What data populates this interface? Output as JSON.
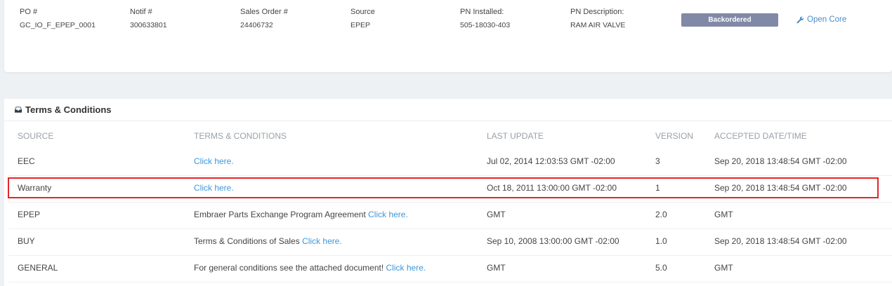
{
  "order": {
    "po_label": "PO #",
    "po_value": "GC_IO_F_EPEP_0001",
    "notif_label": "Notif #",
    "notif_value": "300633801",
    "sales_label": "Sales Order #",
    "sales_value": "24406732",
    "source_label": "Source",
    "source_value": "EPEP",
    "pn_installed_label": "PN Installed:",
    "pn_installed_value": "505-18030-403",
    "pn_desc_label": "PN Description:",
    "pn_desc_value": "RAM AIR VALVE",
    "status_badge": "Backordered",
    "open_core": "Open Core"
  },
  "terms": {
    "title": "Terms & Conditions",
    "headers": {
      "source": "SOURCE",
      "terms": "TERMS & CONDITIONS",
      "last_update": "LAST UPDATE",
      "version": "VERSION",
      "accepted": "ACCEPTED DATE/TIME"
    },
    "rows": [
      {
        "source": "EEC",
        "text": "",
        "link": "Click here.",
        "last_update": "Jul 02, 2014 12:03:53 GMT -02:00",
        "version": "3",
        "accepted": "Sep 20, 2018 13:48:54 GMT -02:00"
      },
      {
        "source": "Warranty",
        "text": "",
        "link": "Click here.",
        "last_update": "Oct 18, 2011 13:00:00 GMT -02:00",
        "version": "1",
        "accepted": "Sep 20, 2018 13:48:54 GMT -02:00"
      },
      {
        "source": "EPEP",
        "text": "Embraer Parts Exchange Program Agreement ",
        "link": "Click here.",
        "last_update": "GMT",
        "version": "2.0",
        "accepted": "GMT"
      },
      {
        "source": "BUY",
        "text": "Terms & Conditions of Sales ",
        "link": "Click here.",
        "last_update": "Sep 10, 2008 13:00:00 GMT -02:00",
        "version": "1.0",
        "accepted": "Sep 20, 2018 13:48:54 GMT -02:00"
      },
      {
        "source": "GENERAL",
        "text": "For general conditions see the attached document! ",
        "link": "Click here.",
        "last_update": "GMT",
        "version": "5.0",
        "accepted": "GMT"
      }
    ]
  },
  "icons": {
    "open_core": "wrench-icon",
    "terms_title": "inbox-icon"
  },
  "colors": {
    "highlight": "#e52528",
    "link": "#3d97d9",
    "badge": "#8089a6"
  }
}
